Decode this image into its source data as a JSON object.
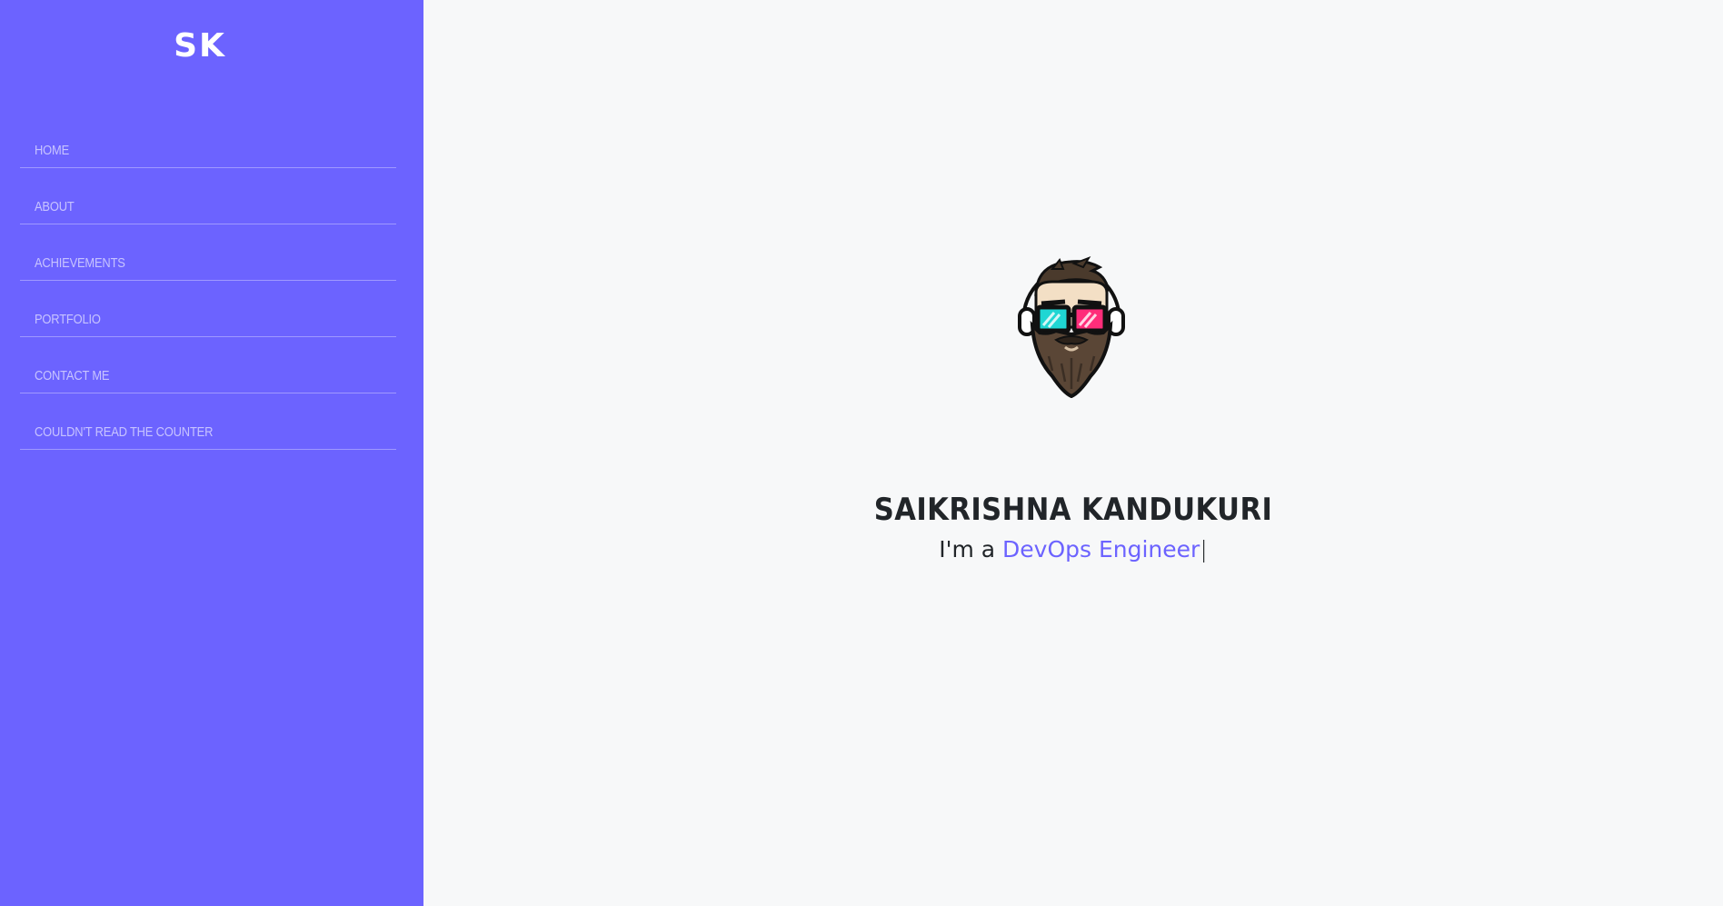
{
  "sidebar": {
    "brand": "SK",
    "items": [
      {
        "label": "HOME"
      },
      {
        "label": "ABOUT"
      },
      {
        "label": "ACHIEVEMENTS"
      },
      {
        "label": "PORTFOLIO"
      },
      {
        "label": "CONTACT ME"
      },
      {
        "label": "COULDN'T READ THE COUNTER"
      }
    ]
  },
  "hero": {
    "name": "SAIKRISHNA KANDUKURI",
    "prefix": "I'm a ",
    "role": "DevOps Engineer",
    "cursor": "|"
  },
  "colors": {
    "accent": "#6c63ff",
    "background": "#f7f8f9",
    "text": "#212529"
  }
}
